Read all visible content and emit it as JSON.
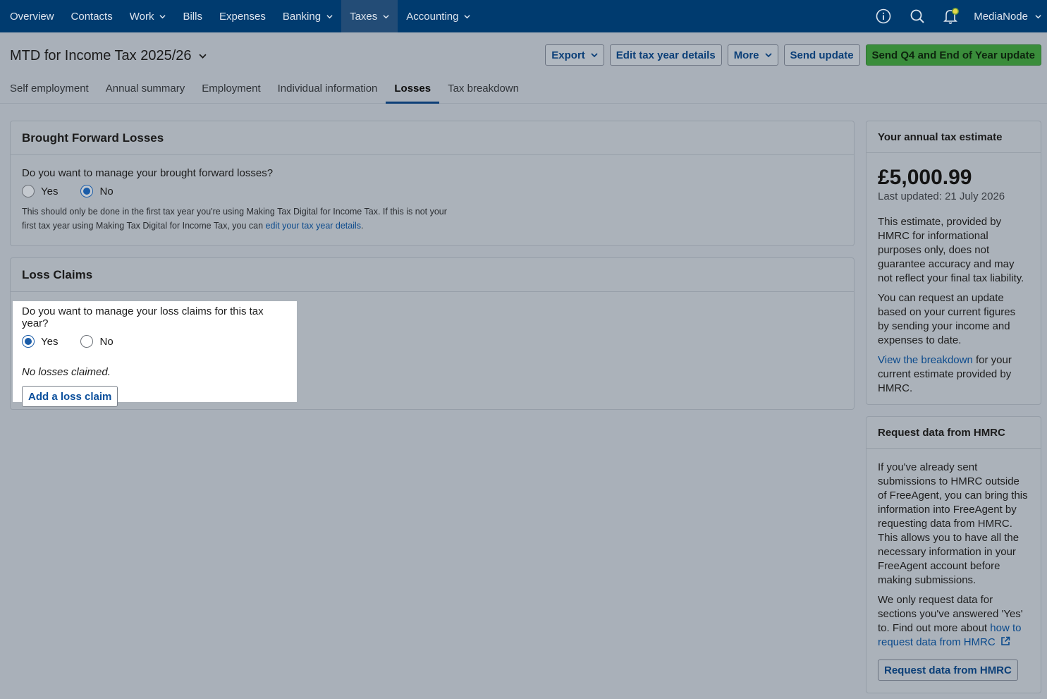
{
  "nav": {
    "items": [
      {
        "label": "Overview",
        "dropdown": false
      },
      {
        "label": "Contacts",
        "dropdown": false
      },
      {
        "label": "Work",
        "dropdown": true
      },
      {
        "label": "Bills",
        "dropdown": false
      },
      {
        "label": "Expenses",
        "dropdown": false
      },
      {
        "label": "Banking",
        "dropdown": true
      },
      {
        "label": "Taxes",
        "dropdown": true,
        "active": true
      },
      {
        "label": "Accounting",
        "dropdown": true
      }
    ],
    "account": "MediaNode"
  },
  "header": {
    "title": "MTD for Income Tax 2025/26",
    "export": "Export",
    "edit": "Edit tax year details",
    "more": "More",
    "send": "Send update",
    "send_final": "Send Q4 and End of Year update"
  },
  "tabs": [
    {
      "label": "Self employment"
    },
    {
      "label": "Annual summary"
    },
    {
      "label": "Employment"
    },
    {
      "label": "Individual information"
    },
    {
      "label": "Losses",
      "active": true
    },
    {
      "label": "Tax breakdown"
    }
  ],
  "brought_forward": {
    "title": "Brought Forward Losses",
    "question": "Do you want to manage your brought forward losses?",
    "yes": "Yes",
    "no": "No",
    "selected": "No",
    "help_text": "This should only be done in the first tax year you're using Making Tax Digital for Income Tax. If this is not your first tax year using Making Tax Digital for Income Tax, you can",
    "help_link": "edit your tax year details",
    "help_end": "."
  },
  "loss_claims": {
    "title": "Loss Claims",
    "question": "Do you want to manage your loss claims for this tax year?",
    "yes": "Yes",
    "no": "No",
    "selected": "Yes",
    "empty": "No losses claimed.",
    "add_button": "Add a loss claim"
  },
  "estimate": {
    "title": "Your annual tax estimate",
    "amount": "£5,000.99",
    "updated": "Last updated: 21 July 2026",
    "p1": "This estimate, provided by HMRC for informational purposes only, does not guarantee accuracy and may not reflect your final tax liability.",
    "p2": "You can request an update based on your current figures by sending your income and expenses to date.",
    "p3_link": "View the breakdown",
    "p3_rest": " for your current estimate provided by HMRC."
  },
  "request": {
    "title": "Request data from HMRC",
    "p1": "If you've already sent submissions to HMRC outside of FreeAgent, you can bring this information into FreeAgent by requesting data from HMRC. This allows you to have all the necessary information in your FreeAgent account before making submissions.",
    "p2": "We only request data for sections you've answered 'Yes' to. Find out more about ",
    "p2_link": "how to request data from HMRC",
    "button": "Request data from HMRC"
  },
  "colors": {
    "nav_bg": "#003b6f",
    "primary_green": "#3a8d3b",
    "link": "#0b4a8c",
    "radio_selected": "#1a5ca8"
  }
}
